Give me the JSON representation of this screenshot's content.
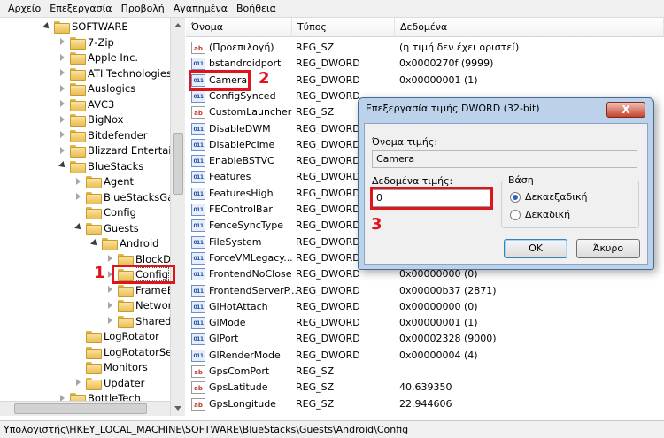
{
  "menu": [
    "Αρχείο",
    "Επεξεργασία",
    "Προβολή",
    "Αγαπημένα",
    "Βοήθεια"
  ],
  "tree": [
    {
      "label": "SOFTWARE",
      "level": 3,
      "exp": "down"
    },
    {
      "label": "7-Zip",
      "level": 4,
      "exp": "right"
    },
    {
      "label": "Apple Inc.",
      "level": 4,
      "exp": "right"
    },
    {
      "label": "ATI Technologies",
      "level": 4,
      "exp": "right"
    },
    {
      "label": "Auslogics",
      "level": 4,
      "exp": "right"
    },
    {
      "label": "AVC3",
      "level": 4,
      "exp": "right"
    },
    {
      "label": "BigNox",
      "level": 4,
      "exp": "right"
    },
    {
      "label": "Bitdefender",
      "level": 4,
      "exp": "right"
    },
    {
      "label": "Blizzard Entertainm",
      "level": 4,
      "exp": "right"
    },
    {
      "label": "BlueStacks",
      "level": 4,
      "exp": "down"
    },
    {
      "label": "Agent",
      "level": 5,
      "exp": "right"
    },
    {
      "label": "BlueStacksGam",
      "level": 5,
      "exp": "right"
    },
    {
      "label": "Config",
      "level": 5,
      "exp": "none"
    },
    {
      "label": "Guests",
      "level": 5,
      "exp": "down"
    },
    {
      "label": "Android",
      "level": 6,
      "exp": "down"
    },
    {
      "label": "BlockD",
      "level": 7,
      "exp": "right"
    },
    {
      "label": "Config",
      "level": 7,
      "exp": "right",
      "selected": true
    },
    {
      "label": "FrameB",
      "level": 7,
      "exp": "right"
    },
    {
      "label": "Networ",
      "level": 7,
      "exp": "right"
    },
    {
      "label": "SharedI",
      "level": 7,
      "exp": "right"
    },
    {
      "label": "LogRotator",
      "level": 5,
      "exp": "none"
    },
    {
      "label": "LogRotatorSer",
      "level": 5,
      "exp": "none"
    },
    {
      "label": "Monitors",
      "level": 5,
      "exp": "none"
    },
    {
      "label": "Updater",
      "level": 5,
      "exp": "right"
    },
    {
      "label": "BottleTech",
      "level": 4,
      "exp": "right"
    }
  ],
  "columns": {
    "name": "Όνομα",
    "type": "Τύπος",
    "data": "Δεδομένα"
  },
  "values": [
    {
      "icon": "ab",
      "name": "(Προεπιλογή)",
      "type": "REG_SZ",
      "data": "(η τιμή δεν έχει οριστεί)"
    },
    {
      "icon": "bin",
      "name": "bstandroidport",
      "type": "REG_DWORD",
      "data": "0x0000270f (9999)"
    },
    {
      "icon": "bin",
      "name": "Camera",
      "type": "REG_DWORD",
      "data": "0x00000001 (1)"
    },
    {
      "icon": "bin",
      "name": "ConfigSynced",
      "type": "REG_DWORD",
      "data": ""
    },
    {
      "icon": "ab",
      "name": "CustomLauncher",
      "type": "REG_SZ",
      "data": ""
    },
    {
      "icon": "bin",
      "name": "DisableDWM",
      "type": "REG_DWORD",
      "data": ""
    },
    {
      "icon": "bin",
      "name": "DisablePcIme",
      "type": "REG_DWORD",
      "data": ""
    },
    {
      "icon": "bin",
      "name": "EnableBSTVC",
      "type": "REG_DWORD",
      "data": ""
    },
    {
      "icon": "bin",
      "name": "Features",
      "type": "REG_DWORD",
      "data": ""
    },
    {
      "icon": "bin",
      "name": "FeaturesHigh",
      "type": "REG_DWORD",
      "data": ""
    },
    {
      "icon": "bin",
      "name": "FEControlBar",
      "type": "REG_DWORD",
      "data": ""
    },
    {
      "icon": "bin",
      "name": "FenceSyncType",
      "type": "REG_DWORD",
      "data": ""
    },
    {
      "icon": "bin",
      "name": "FileSystem",
      "type": "REG_DWORD",
      "data": ""
    },
    {
      "icon": "bin",
      "name": "ForceVMLegacy...",
      "type": "REG_DWORD",
      "data": ""
    },
    {
      "icon": "bin",
      "name": "FrontendNoClose",
      "type": "REG_DWORD",
      "data": "0x00000000 (0)"
    },
    {
      "icon": "bin",
      "name": "FrontendServerP...",
      "type": "REG_DWORD",
      "data": "0x00000b37 (2871)"
    },
    {
      "icon": "bin",
      "name": "GlHotAttach",
      "type": "REG_DWORD",
      "data": "0x00000000 (0)"
    },
    {
      "icon": "bin",
      "name": "GlMode",
      "type": "REG_DWORD",
      "data": "0x00000001 (1)"
    },
    {
      "icon": "bin",
      "name": "GlPort",
      "type": "REG_DWORD",
      "data": "0x00002328 (9000)"
    },
    {
      "icon": "bin",
      "name": "GlRenderMode",
      "type": "REG_DWORD",
      "data": "0x00000004 (4)"
    },
    {
      "icon": "ab",
      "name": "GpsComPort",
      "type": "REG_SZ",
      "data": ""
    },
    {
      "icon": "ab",
      "name": "GpsLatitude",
      "type": "REG_SZ",
      "data": "40.639350"
    },
    {
      "icon": "ab",
      "name": "GpsLongitude",
      "type": "REG_SZ",
      "data": "22.944606"
    }
  ],
  "status": "Υπολογιστής\\HKEY_LOCAL_MACHINE\\SOFTWARE\\BlueStacks\\Guests\\Android\\Config",
  "dialog": {
    "title": "Επεξεργασία τιμής DWORD (32-bit)",
    "close": "X",
    "name_label": "Όνομα τιμής:",
    "name_value": "Camera",
    "data_label": "Δεδομένα τιμής:",
    "data_value": "0",
    "base_label": "Βάση",
    "radio_hex": "Δεκαεξαδική",
    "radio_dec": "Δεκαδική",
    "ok": "OK",
    "cancel": "Άκυρο"
  },
  "annotations": {
    "one": "1",
    "two": "2",
    "three": "3"
  },
  "colors": {
    "annotation_red": "#e0141b",
    "dialog_frame": "#bcd1ea"
  }
}
